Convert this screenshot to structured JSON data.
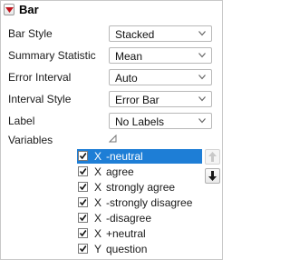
{
  "header": {
    "title": "Bar"
  },
  "settings": [
    {
      "label": "Bar Style",
      "value": "Stacked"
    },
    {
      "label": "Summary Statistic",
      "value": "Mean"
    },
    {
      "label": "Error Interval",
      "value": "Auto"
    },
    {
      "label": "Interval Style",
      "value": "Error Bar"
    },
    {
      "label": "Label",
      "value": "No Labels"
    }
  ],
  "variables": {
    "label": "Variables",
    "items": [
      {
        "checked": true,
        "role": "X",
        "name": "-neutral",
        "selected": true
      },
      {
        "checked": true,
        "role": "X",
        "name": "agree",
        "selected": false
      },
      {
        "checked": true,
        "role": "X",
        "name": "strongly agree",
        "selected": false
      },
      {
        "checked": true,
        "role": "X",
        "name": "-strongly disagree",
        "selected": false
      },
      {
        "checked": true,
        "role": "X",
        "name": "-disagree",
        "selected": false
      },
      {
        "checked": true,
        "role": "X",
        "name": "+neutral",
        "selected": false
      },
      {
        "checked": true,
        "role": "Y",
        "name": "question",
        "selected": false
      }
    ],
    "move_up_enabled": false,
    "move_down_enabled": true
  },
  "colors": {
    "accent": "#1e7ed6",
    "collapse_arrow": "#c0141c"
  },
  "icons": {
    "collapse": "triangle-down-red-icon",
    "combo_arrow": "chevron-down-icon",
    "variables_toggle": "triangle-expand-icon",
    "move_up": "arrow-up-icon",
    "move_down": "arrow-down-icon",
    "check": "checkmark-icon"
  }
}
